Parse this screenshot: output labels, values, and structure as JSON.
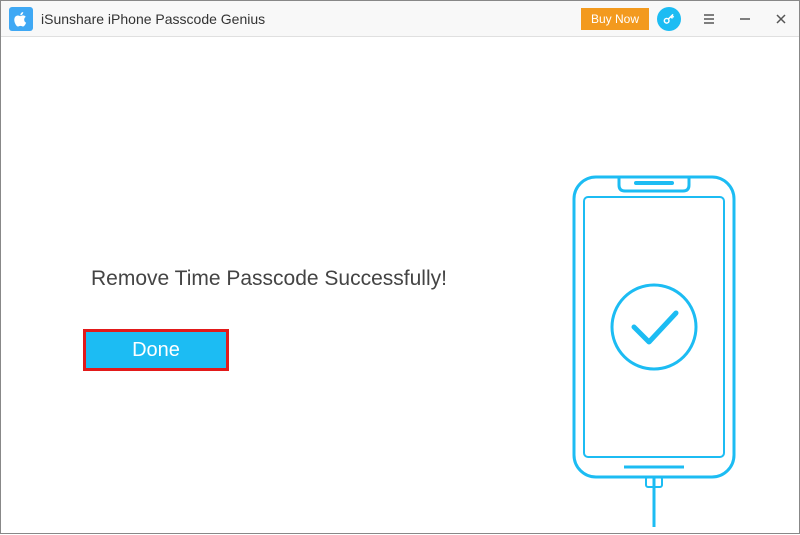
{
  "titlebar": {
    "app_title": "iSunshare iPhone Passcode Genius",
    "buy_now_label": "Buy Now"
  },
  "main": {
    "message": "Remove Time Passcode Successfully!",
    "done_label": "Done"
  },
  "colors": {
    "accent": "#1cbcf3",
    "buy_now": "#f39a1e",
    "highlight_border": "#e21a1a"
  }
}
